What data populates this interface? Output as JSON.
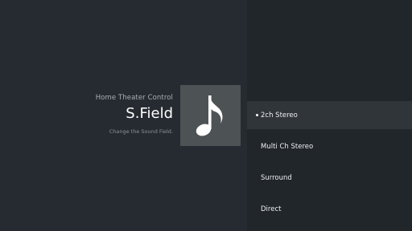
{
  "header": {
    "breadcrumb": "Home Theater Control",
    "title": "S.Field",
    "description": "Change the Sound Field."
  },
  "tile": {
    "icon": "music-note-icon"
  },
  "options": {
    "items": [
      {
        "label": "2ch Stereo",
        "selected": true
      },
      {
        "label": "Multi Ch Stereo",
        "selected": false
      },
      {
        "label": "Surround",
        "selected": false
      },
      {
        "label": "Direct",
        "selected": false
      }
    ]
  },
  "colors": {
    "background": "#262b31",
    "right_pane": "#21262b",
    "selected_row": "#30353a",
    "icon_tile": "#4d5255"
  }
}
